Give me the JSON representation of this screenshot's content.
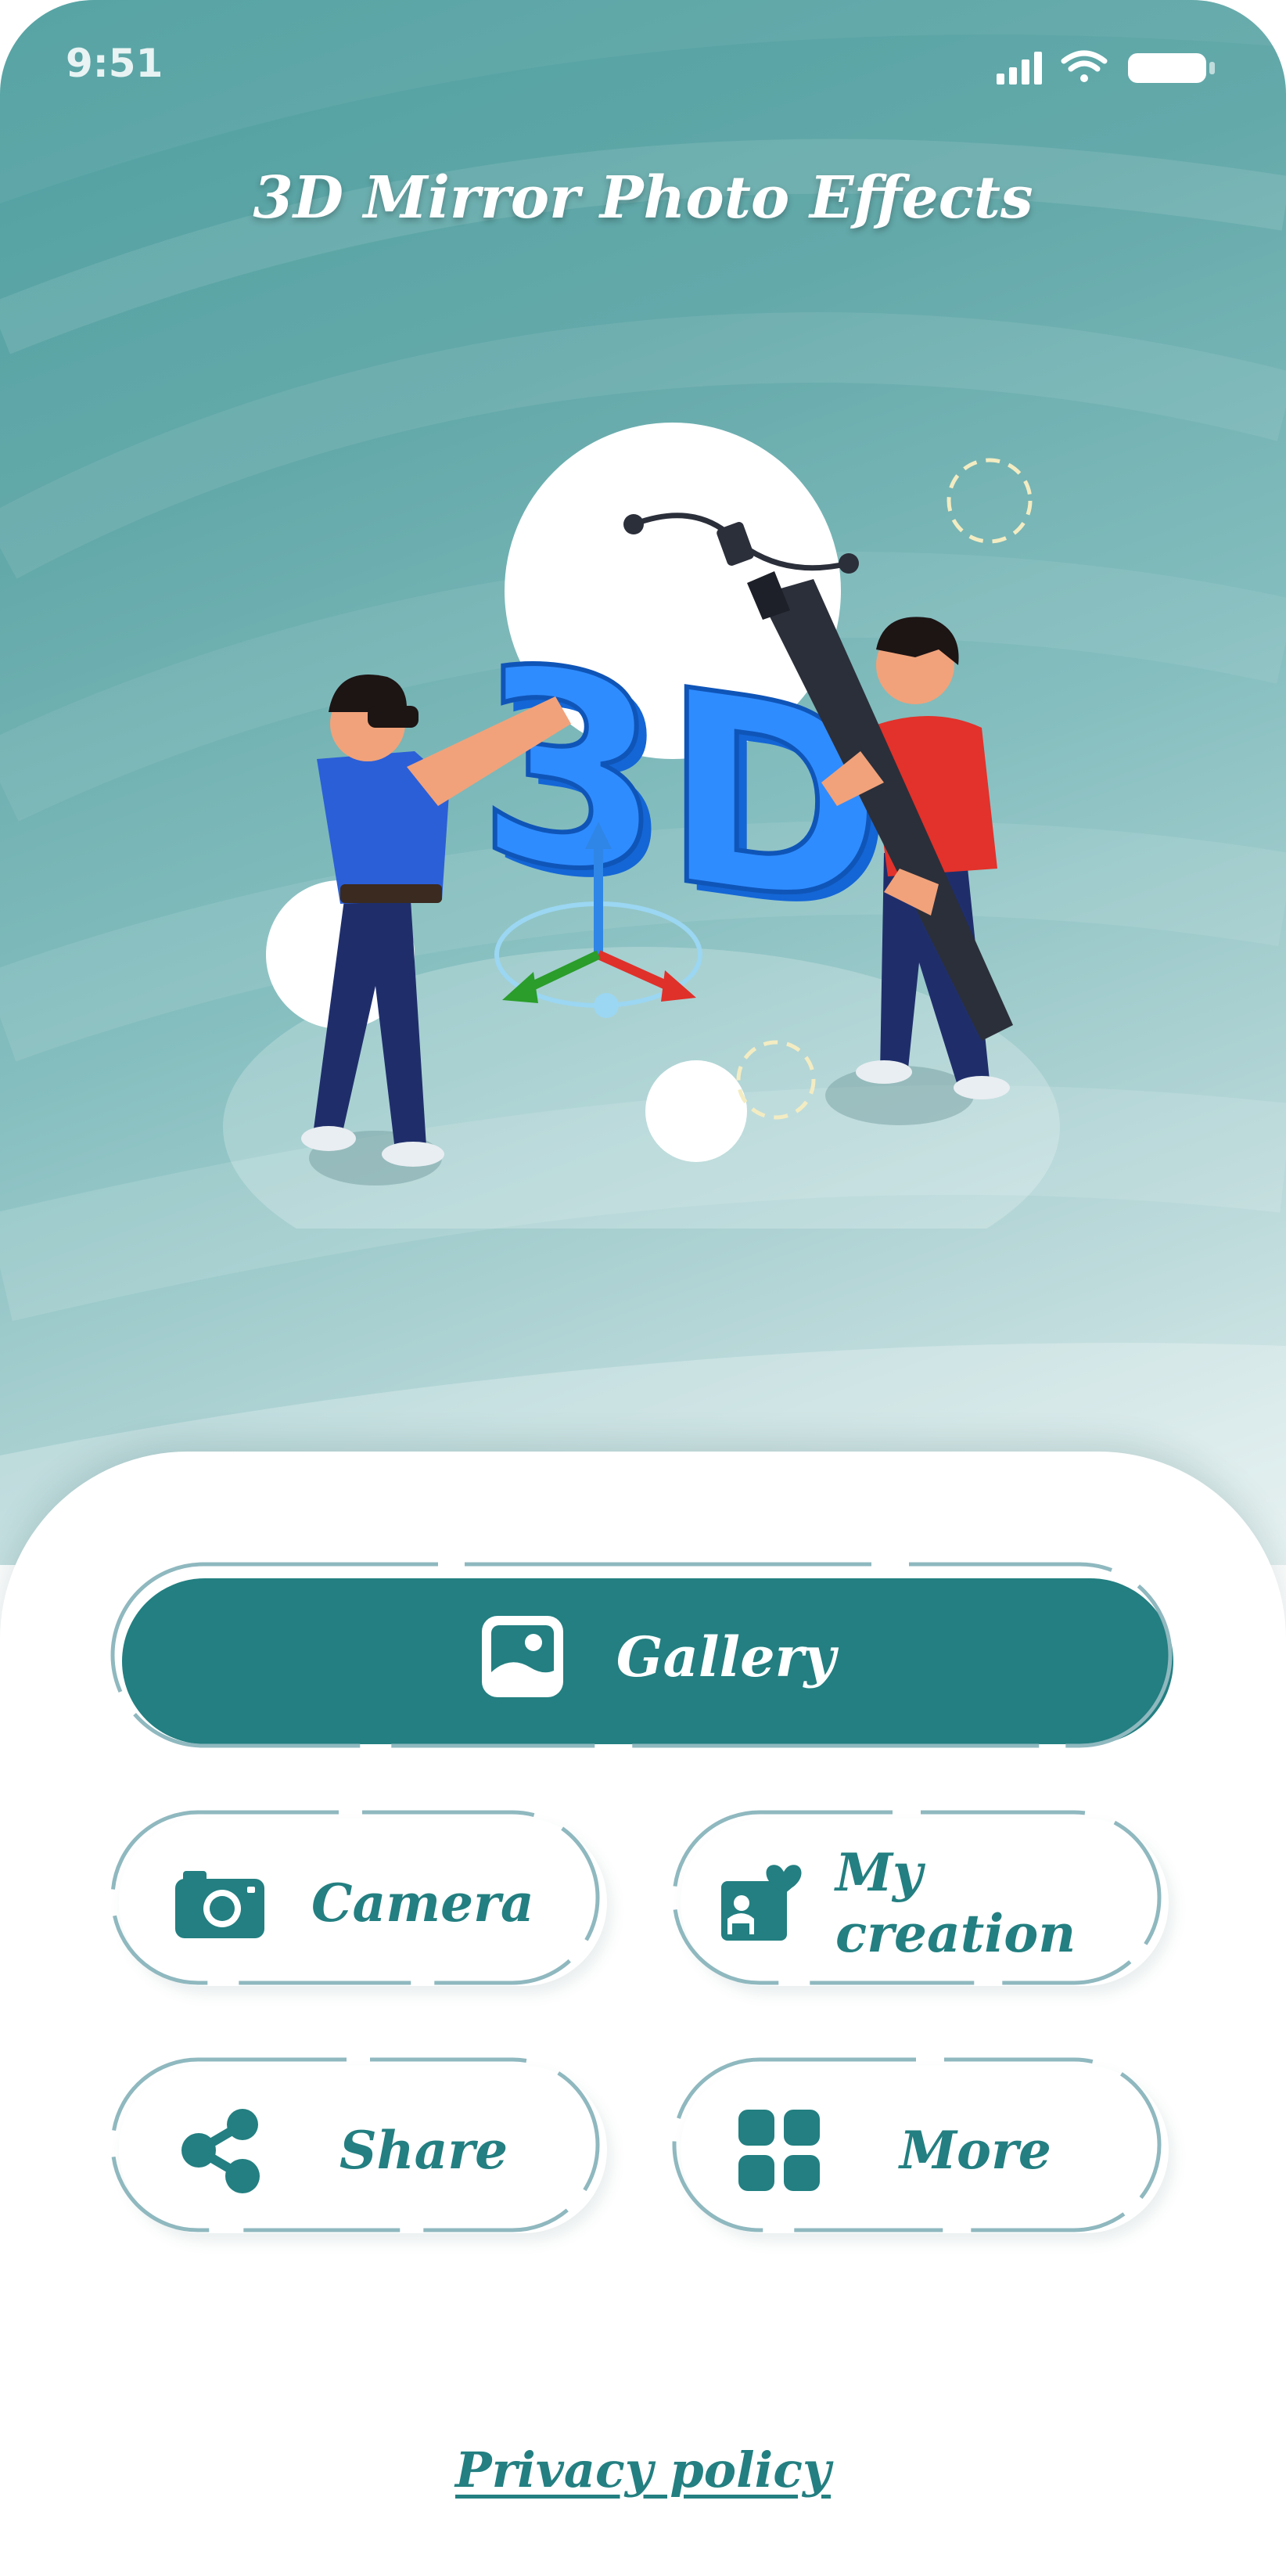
{
  "status_bar": {
    "time": "9:51"
  },
  "app": {
    "title": "3D Mirror Photo Effects"
  },
  "illustration": {
    "badge_text": "3D"
  },
  "buttons": {
    "gallery": "Gallery",
    "camera": "Camera",
    "my_creation": "My creation",
    "share": "Share",
    "more": "More"
  },
  "footer": {
    "privacy_policy": "Privacy policy"
  },
  "colors": {
    "accent": "#237f81",
    "hero_top": "#4f9fa0",
    "hero_bottom": "#dfeded",
    "outline": "#8fb8bf"
  },
  "icons": {
    "gallery": "image-icon",
    "camera": "camera-icon",
    "my_creation": "image-heart-icon",
    "share": "share-icon",
    "more": "grid-icon"
  }
}
